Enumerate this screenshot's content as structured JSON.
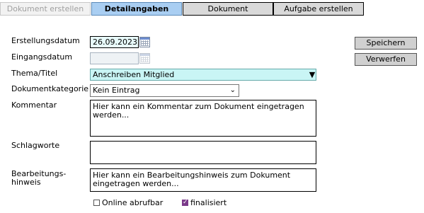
{
  "tabs": [
    {
      "label": "Dokument erstellen",
      "state": "disabled"
    },
    {
      "label": "Detailangaben",
      "state": "active"
    },
    {
      "label": "Dokument",
      "state": "normal"
    },
    {
      "label": "Aufgabe erstellen",
      "state": "normal"
    }
  ],
  "form": {
    "created_label": "Erstellungsdatum",
    "created_value": "26.09.2023",
    "received_label": "Eingangsdatum",
    "received_value": "",
    "theme_label": "Thema/Titel",
    "theme_value": "Anschreiben Mitglied",
    "category_label": "Dokumentkategorie",
    "category_value": "Kein Eintrag",
    "comment_label": "Kommentar",
    "comment_value": "Hier kann ein Kommentar zum Dokument eingetragen werden...",
    "keywords_label": "Schlagworte",
    "keywords_value": "",
    "note_label_line1": "Bearbeitungs-",
    "note_label_line2": "hinweis",
    "note_value": "Hier kann ein Bearbeitungshinweis zum Dokument eingetragen werden...",
    "online_label": "Online abrufbar",
    "online_checked": false,
    "finalized_label": "finalisiert",
    "finalized_checked": true
  },
  "actions": {
    "save_label": "Speichern",
    "discard_label": "Verwerfen"
  },
  "icons": {
    "calendar": "calendar-icon",
    "dropdown": "triangle-down-icon",
    "chevron": "chevron-down-icon",
    "check": "check-icon"
  },
  "colors": {
    "active_tab": "#a9cef2",
    "theme_field": "#c9f5f5",
    "checkbox_checked": "#7b3a8a"
  }
}
